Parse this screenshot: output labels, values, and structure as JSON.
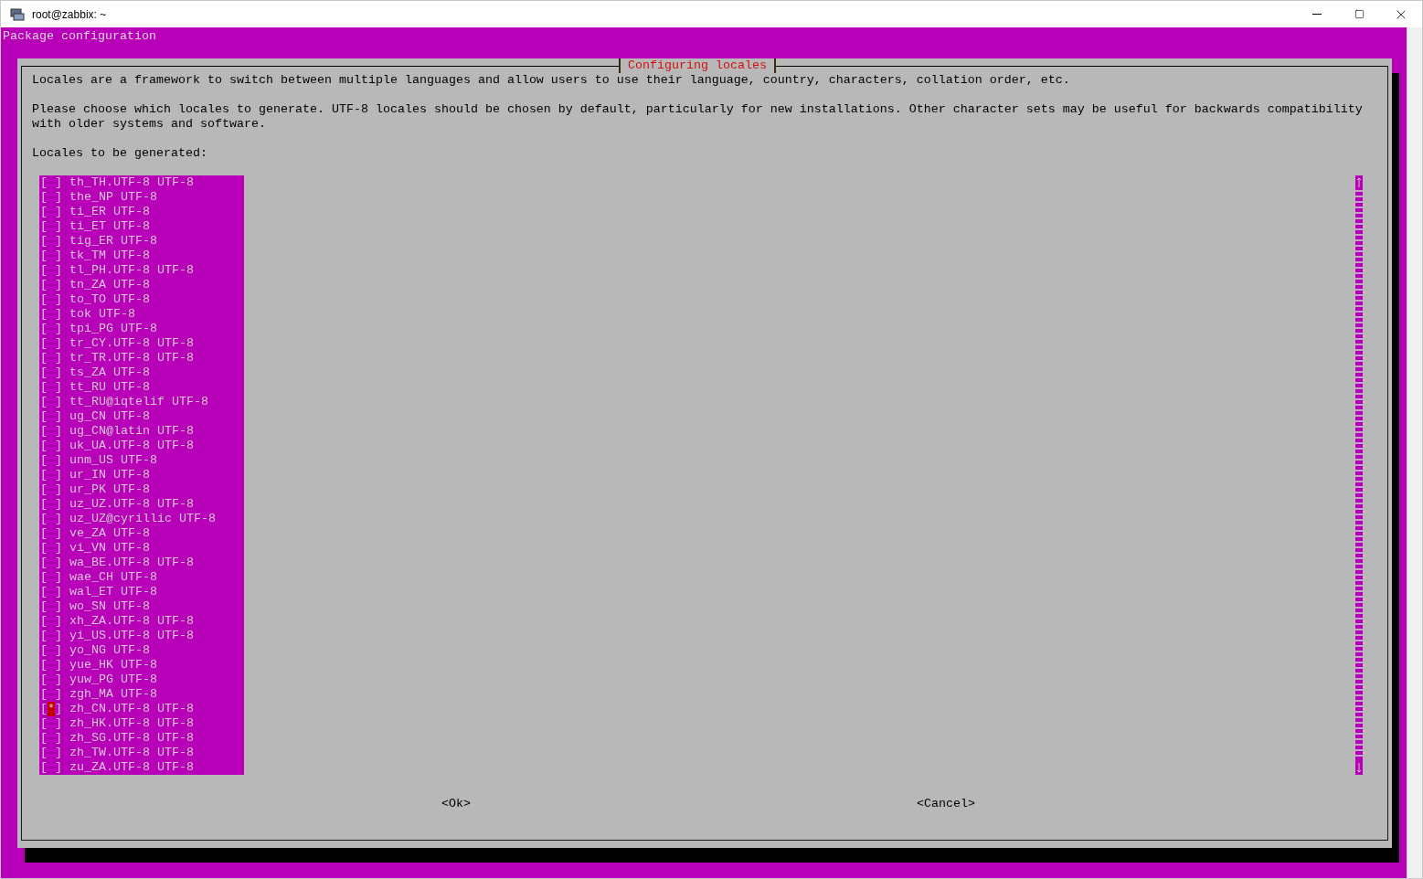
{
  "window": {
    "title": "root@zabbix: ~"
  },
  "terminal": {
    "header": "Package configuration"
  },
  "dialog": {
    "title": "Configuring locales",
    "paragraphs": [
      "Locales are a framework to switch between multiple languages and allow users to use their language, country, characters, collation order, etc.",
      "Please choose which locales to generate. UTF-8 locales should be chosen by default, particularly for new installations. Other character sets may be useful for backwards compatibility with older systems and software.",
      "Locales to be generated:"
    ],
    "checkbox_glyphs": {
      "open": "[",
      "close": "]",
      "mark": "*"
    },
    "locales": [
      {
        "label": "th_TH.UTF-8 UTF-8",
        "checked": false
      },
      {
        "label": "the_NP UTF-8",
        "checked": false
      },
      {
        "label": "ti_ER UTF-8",
        "checked": false
      },
      {
        "label": "ti_ET UTF-8",
        "checked": false
      },
      {
        "label": "tig_ER UTF-8",
        "checked": false
      },
      {
        "label": "tk_TM UTF-8",
        "checked": false
      },
      {
        "label": "tl_PH.UTF-8 UTF-8",
        "checked": false
      },
      {
        "label": "tn_ZA UTF-8",
        "checked": false
      },
      {
        "label": "to_TO UTF-8",
        "checked": false
      },
      {
        "label": "tok UTF-8",
        "checked": false
      },
      {
        "label": "tpi_PG UTF-8",
        "checked": false
      },
      {
        "label": "tr_CY.UTF-8 UTF-8",
        "checked": false
      },
      {
        "label": "tr_TR.UTF-8 UTF-8",
        "checked": false
      },
      {
        "label": "ts_ZA UTF-8",
        "checked": false
      },
      {
        "label": "tt_RU UTF-8",
        "checked": false
      },
      {
        "label": "tt_RU@iqtelif UTF-8",
        "checked": false
      },
      {
        "label": "ug_CN UTF-8",
        "checked": false
      },
      {
        "label": "ug_CN@latin UTF-8",
        "checked": false
      },
      {
        "label": "uk_UA.UTF-8 UTF-8",
        "checked": false
      },
      {
        "label": "unm_US UTF-8",
        "checked": false
      },
      {
        "label": "ur_IN UTF-8",
        "checked": false
      },
      {
        "label": "ur_PK UTF-8",
        "checked": false
      },
      {
        "label": "uz_UZ.UTF-8 UTF-8",
        "checked": false
      },
      {
        "label": "uz_UZ@cyrillic UTF-8",
        "checked": false
      },
      {
        "label": "ve_ZA UTF-8",
        "checked": false
      },
      {
        "label": "vi_VN UTF-8",
        "checked": false
      },
      {
        "label": "wa_BE.UTF-8 UTF-8",
        "checked": false
      },
      {
        "label": "wae_CH UTF-8",
        "checked": false
      },
      {
        "label": "wal_ET UTF-8",
        "checked": false
      },
      {
        "label": "wo_SN UTF-8",
        "checked": false
      },
      {
        "label": "xh_ZA.UTF-8 UTF-8",
        "checked": false
      },
      {
        "label": "yi_US.UTF-8 UTF-8",
        "checked": false
      },
      {
        "label": "yo_NG UTF-8",
        "checked": false
      },
      {
        "label": "yue_HK UTF-8",
        "checked": false
      },
      {
        "label": "yuw_PG UTF-8",
        "checked": false
      },
      {
        "label": "zgh_MA UTF-8",
        "checked": false
      },
      {
        "label": "zh_CN.UTF-8 UTF-8",
        "checked": true
      },
      {
        "label": "zh_HK.UTF-8 UTF-8",
        "checked": false
      },
      {
        "label": "zh_SG.UTF-8 UTF-8",
        "checked": false
      },
      {
        "label": "zh_TW.UTF-8 UTF-8",
        "checked": false
      },
      {
        "label": "zu_ZA.UTF-8 UTF-8",
        "checked": false
      }
    ],
    "buttons": [
      "<Ok>",
      "<Cancel>"
    ]
  }
}
